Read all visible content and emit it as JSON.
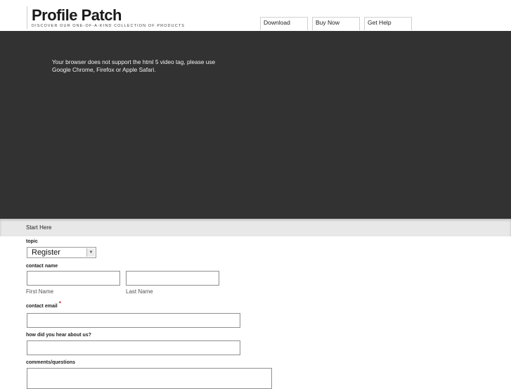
{
  "header": {
    "brand_title": "Profile Patch",
    "brand_tagline": "Discover our one-of-a-kind collection of products",
    "nav": [
      {
        "label": "Download"
      },
      {
        "label": "Buy Now"
      },
      {
        "label": "Get Help"
      }
    ]
  },
  "video": {
    "message": "Your browser does not support the html 5 video tag, please use Google Chrome, Firefox or Apple Safari."
  },
  "section": {
    "title": "Start Here"
  },
  "form": {
    "topic_label": "topic",
    "topic_value": "Register",
    "contact_name_label": "contact name",
    "first_name_hint": "First Name",
    "last_name_hint": "Last Name",
    "contact_email_label": "contact email",
    "required_marker": "*",
    "hear_label": "how did you hear about us?",
    "comments_label": "comments/questions"
  },
  "icons": {
    "select_arrow": "chevron-down-icon"
  }
}
